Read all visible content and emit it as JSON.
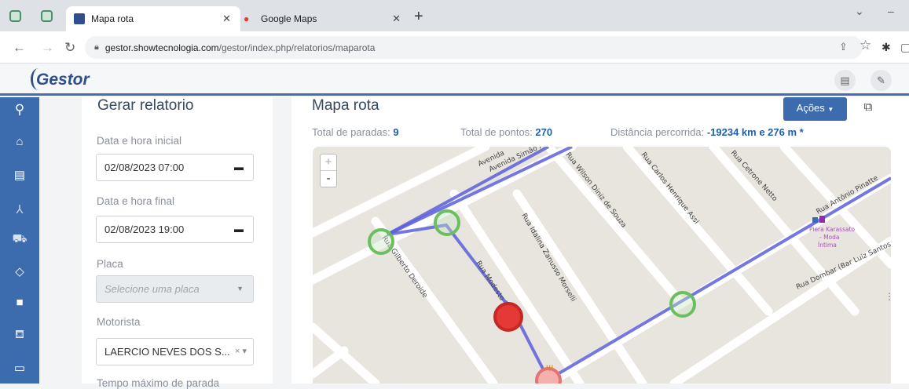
{
  "browser": {
    "tabs": [
      {
        "title": "Mapa rota",
        "active": true
      },
      {
        "title": "Google Maps",
        "active": false
      }
    ],
    "url": {
      "host": "gestor.showtecnologia.com",
      "path": "/gestor/index.php/relatorios/maparota"
    }
  },
  "app": {
    "logo": "Gestor"
  },
  "form": {
    "title": "Gerar relatorio",
    "start_label": "Data e hora inicial",
    "start_value": "02/08/2023 07:00",
    "end_label": "Data e hora final",
    "end_value": "02/08/2023 19:00",
    "plate_label": "Placa",
    "plate_placeholder": "Selecione uma placa",
    "driver_label": "Motorista",
    "driver_value": "LAERCIO NEVES DOS S...",
    "max_stop_label": "Tempo máximo de parada"
  },
  "main": {
    "title": "Mapa rota",
    "actions_label": "Ações",
    "stops_label": "Total de paradas:",
    "stops_value": "9",
    "points_label": "Total de pontos:",
    "points_value": "270",
    "distance_label": "Distância percorrida:",
    "distance_value": "-19234 km e 276 m *"
  },
  "map": {
    "zoom_in": "+",
    "zoom_out": "-",
    "streets": [
      "Avenida Simão Alv",
      "Avenida",
      "Rua Wilson Diniz de Souza",
      "Rua Carlos Henrique Assi",
      "Rua Cetrone Netto",
      "Rua Antônio Pinatte",
      "Rua Idalina Zanusso Morselli",
      "Rua Gilberto Deroide",
      "Rua Dombar (Bar Luiz Santos",
      "Rua Modesto Zuliani"
    ],
    "poi": [
      "Piera Karassato",
      "- Moda",
      "Íntima"
    ],
    "route_color": "#5b5fdc",
    "stop_color": "#6abf5e",
    "alert_color": "#e53935"
  }
}
